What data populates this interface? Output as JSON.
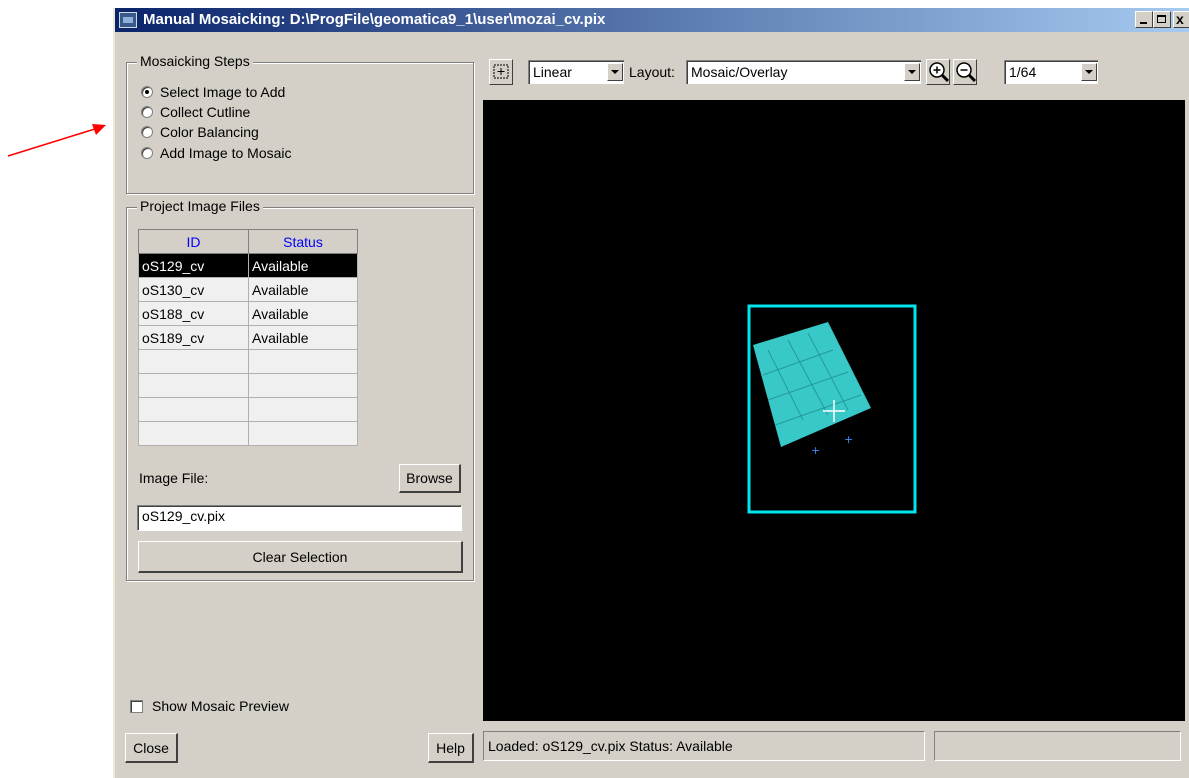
{
  "window": {
    "title": "Manual Mosaicking: D:\\ProgFile\\geomatica9_1\\user\\mozai_cv.pix"
  },
  "steps": {
    "legend": "Mosaicking Steps",
    "options": [
      {
        "label": "Select Image to Add",
        "checked": true
      },
      {
        "label": "Collect Cutline",
        "checked": false
      },
      {
        "label": "Color Balancing",
        "checked": false
      },
      {
        "label": "Add Image to Mosaic",
        "checked": false
      }
    ]
  },
  "files": {
    "legend": "Project Image Files",
    "columns": [
      "ID",
      "Status"
    ],
    "rows": [
      [
        "oS129_cv",
        "Available"
      ],
      [
        "oS130_cv",
        "Available"
      ],
      [
        "oS188_cv",
        "Available"
      ],
      [
        "oS189_cv",
        "Available"
      ],
      [
        "",
        ""
      ],
      [
        "",
        ""
      ],
      [
        "",
        ""
      ],
      [
        "",
        ""
      ]
    ],
    "image_file_label": "Image File:",
    "browse_label": "Browse",
    "image_file_value": "oS129_cv.pix",
    "clear_label": "Clear Selection"
  },
  "preview": {
    "label": "Show Mosaic Preview",
    "checked": false
  },
  "buttons": {
    "close": "Close",
    "help": "Help"
  },
  "toolbar": {
    "stretch": "Linear",
    "layout_label": "Layout:",
    "layout": "Mosaic/Overlay",
    "zoom": "1/64"
  },
  "status": {
    "message": "Loaded: oS129_cv.pix  Status: Available",
    "secondary": ""
  },
  "colors": {
    "viewer_bg": "#000000",
    "footprint": "#00e5ee",
    "image": "#38c8c8",
    "arrow": "#ff0000"
  }
}
